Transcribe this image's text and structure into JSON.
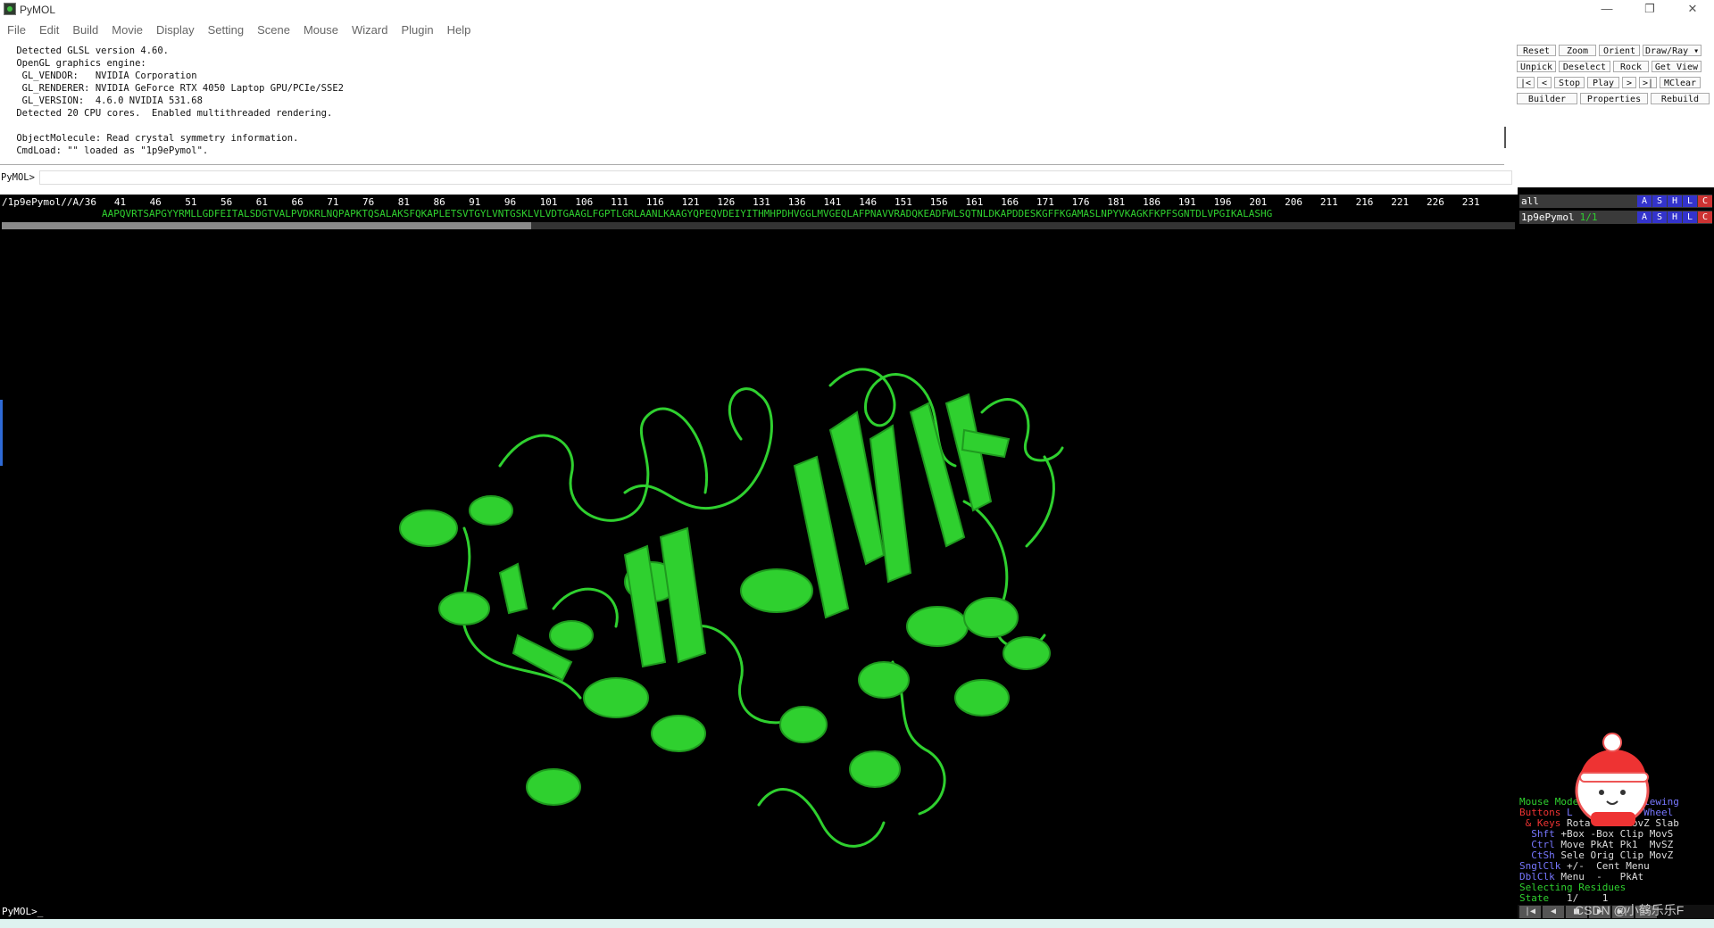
{
  "window": {
    "title": "PyMOL",
    "minimize_glyph": "—",
    "restore_glyph": "❐",
    "close_glyph": "✕"
  },
  "menu": [
    "File",
    "Edit",
    "Build",
    "Movie",
    "Display",
    "Setting",
    "Scene",
    "Mouse",
    "Wizard",
    "Plugin",
    "Help"
  ],
  "console": {
    "lines": [
      " Detected GLSL version 4.60.",
      " OpenGL graphics engine:",
      "  GL_VENDOR:   NVIDIA Corporation",
      "  GL_RENDERER: NVIDIA GeForce RTX 4050 Laptop GPU/PCIe/SSE2",
      "  GL_VERSION:  4.6.0 NVIDIA 531.68",
      " Detected 20 CPU cores.  Enabled multithreaded rendering.",
      "",
      " ObjectMolecule: Read crystal symmetry information.",
      " CmdLoad: \"\" loaded as \"1p9ePymol\"."
    ]
  },
  "command": {
    "prompt": "PyMOL>",
    "value": "",
    "bottom_prompt": "PyMOL>_"
  },
  "internal_gui": {
    "row1": [
      "Reset",
      "Zoom",
      "Orient",
      "Draw/Ray ▾"
    ],
    "row2": [
      "Unpick",
      "Deselect",
      "Rock",
      "Get View"
    ],
    "row3": [
      "|<",
      "<",
      "Stop",
      "Play",
      ">",
      ">|",
      "MClear"
    ],
    "row4": [
      "Builder",
      "Properties",
      "Rebuild"
    ]
  },
  "sequence": {
    "numbers": "/1p9ePymol//A/36   41    46    51    56    61    66    71    76    81    86    91    96    101   106   111   116   121   126   131   136   141   146   151   156   161   166   171   176   181   186   191   196   201   206   211   216   221   226   231",
    "residues": "AAPQVRTSAPGYYRMLLGDFEITALSDGTVALPVDKRLNQPAPKTQSALAKSFQKAPLETSVTGYLVNTGSKLVLVDTGAAGLFGPTLGRLAANLKAAGYQPEQVDEIYITHMHPDHVGGLMVGEQLAFPNAVVRADQKEADFWLSQTNLDKAPDDESKGFFKGAMASLNPYVKAGKFKPFSGNTDLVPGIKALASHG",
    "scroll_fraction": 0.35
  },
  "objects": [
    {
      "name": "all",
      "state": "",
      "buttons": [
        "A",
        "S",
        "H",
        "L",
        "C"
      ]
    },
    {
      "name": "1p9ePymol",
      "state": "1/1",
      "buttons": [
        "A",
        "S",
        "H",
        "L",
        "C"
      ]
    }
  ],
  "colors": {
    "A": "#3333cc",
    "S": "#3333cc",
    "H": "#3333cc",
    "L": "#3333cc",
    "C": "#cc3333",
    "cartoon": "#2fd02f"
  },
  "mouse_help": {
    "line1_a": "Mouse Mode ",
    "line1_b": "3-Button Viewing",
    "line2_a": "Buttons ",
    "line2_b": "L    M    R  Wheel",
    "line3_a": " & Keys ",
    "line3_b": "Rota Move MovZ Slab",
    "line4_a": "  Shft ",
    "line4_b": "+Box -Box Clip MovS",
    "line5_a": "  Ctrl ",
    "line5_b": "Move PkAt Pk1  MvSZ",
    "line6_a": "  CtSh ",
    "line6_b": "Sele Orig Clip MovZ",
    "line7_a": "SnglClk ",
    "line7_b": "+/-  Cent Menu",
    "line8_a": "DblClk ",
    "line8_b": "Menu  -   PkAt",
    "line9": "Selecting Residues",
    "line10_a": "State ",
    "line10_b": "  1/    1"
  },
  "movie_controls": [
    "|◀",
    "◀",
    "■",
    "▶",
    "▶|",
    "↺"
  ],
  "watermark": "CSDN @小鹤乐乐F"
}
